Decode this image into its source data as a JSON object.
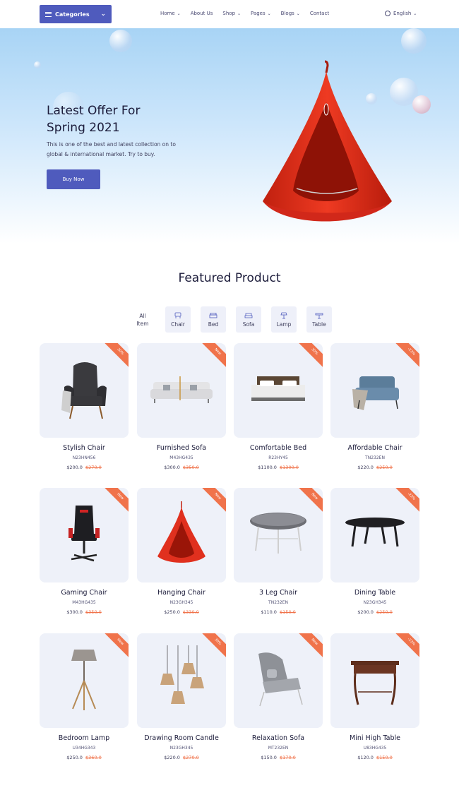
{
  "header": {
    "categories_label": "Categories",
    "nav": [
      {
        "label": "Home",
        "dropdown": true
      },
      {
        "label": "About Us",
        "dropdown": false
      },
      {
        "label": "Shop",
        "dropdown": true
      },
      {
        "label": "Pages",
        "dropdown": true
      },
      {
        "label": "Blogs",
        "dropdown": true
      },
      {
        "label": "Contact",
        "dropdown": false
      }
    ],
    "language": "English"
  },
  "hero": {
    "title_line1": "Latest Offer For",
    "title_line2": "Spring 2021",
    "text": "This is one of the best and latest collection on to global & international market. Try to buy.",
    "button": "Buy Now"
  },
  "featured": {
    "title": "Featured Product",
    "filters": [
      {
        "label": "All Item",
        "icon": "none"
      },
      {
        "label": "Chair",
        "icon": "chair-icon"
      },
      {
        "label": "Bed",
        "icon": "bed-icon"
      },
      {
        "label": "Sofa",
        "icon": "sofa-icon"
      },
      {
        "label": "Lamp",
        "icon": "lamp-icon"
      },
      {
        "label": "Table",
        "icon": "table-icon"
      }
    ],
    "products": [
      {
        "name": "Stylish Chair",
        "sku": "N23HN456",
        "price": "$200.0",
        "old_price": "$270.0",
        "tag": "30%"
      },
      {
        "name": "Furnished Sofa",
        "sku": "M43HG435",
        "price": "$300.0",
        "old_price": "$350.0",
        "tag": "New"
      },
      {
        "name": "Comfortable Bed",
        "sku": "R23HY45",
        "price": "$1100.0",
        "old_price": "$1300.0",
        "tag": "30%"
      },
      {
        "name": "Affordable Chair",
        "sku": "TN232EN",
        "price": "$220.0",
        "old_price": "$250.0",
        "tag": "-23%"
      },
      {
        "name": "Gaming Chair",
        "sku": "M43HG435",
        "price": "$300.0",
        "old_price": "$350.0",
        "tag": "New"
      },
      {
        "name": "Hanging Chair",
        "sku": "N23GH345",
        "price": "$250.0",
        "old_price": "$330.0",
        "tag": "New"
      },
      {
        "name": "3 Leg Chair",
        "sku": "TN232EN",
        "price": "$110.0",
        "old_price": "$150.0",
        "tag": "New"
      },
      {
        "name": "Dining Table",
        "sku": "N23GH345",
        "price": "$200.0",
        "old_price": "$250.0",
        "tag": "-23%"
      },
      {
        "name": "Bedroom Lamp",
        "sku": "U34HG343",
        "price": "$250.0",
        "old_price": "$360.0",
        "tag": "New"
      },
      {
        "name": "Drawing Room Candle",
        "sku": "N23GH345",
        "price": "$220.0",
        "old_price": "$270.0",
        "tag": "30%"
      },
      {
        "name": "Relaxation Sofa",
        "sku": "MT232EN",
        "price": "$150.0",
        "old_price": "$170.0",
        "tag": "New"
      },
      {
        "name": "Mini High Table",
        "sku": "U83HG435",
        "price": "$120.0",
        "old_price": "$150.0",
        "tag": "-23%"
      }
    ]
  },
  "colors": {
    "accent": "#4f5bbd",
    "tag": "#f0734b",
    "hero_red": "#e0301e"
  }
}
